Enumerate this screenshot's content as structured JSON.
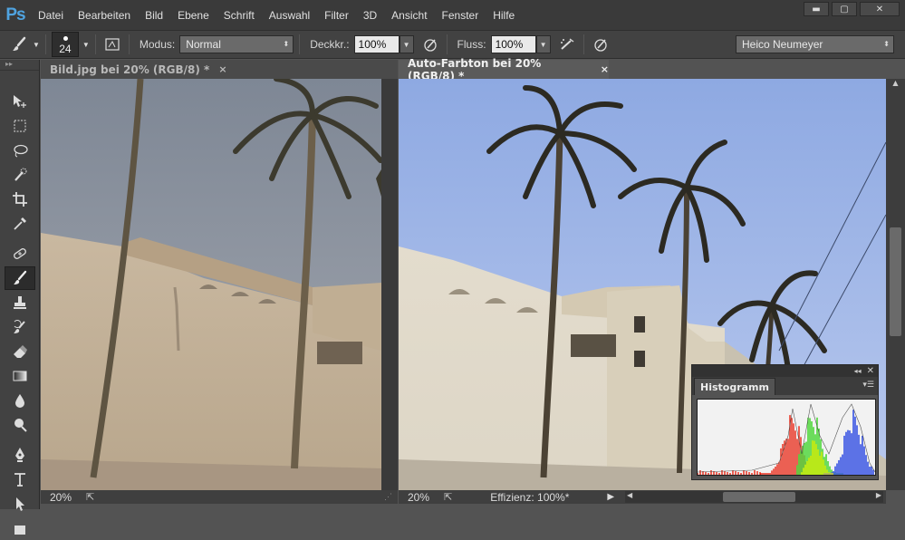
{
  "app": {
    "logo": "Ps"
  },
  "menu": [
    "Datei",
    "Bearbeiten",
    "Bild",
    "Ebene",
    "Schrift",
    "Auswahl",
    "Filter",
    "3D",
    "Ansicht",
    "Fenster",
    "Hilfe"
  ],
  "window_controls": {
    "minimize": "▬",
    "restore": "▢",
    "close": "✕"
  },
  "options": {
    "brush_size": "24",
    "mode_label": "Modus:",
    "mode_value": "Normal",
    "opacity_label": "Deckkr.:",
    "opacity_value": "100%",
    "flow_label": "Fluss:",
    "flow_value": "100%",
    "workspace": "Heico Neumeyer"
  },
  "documents": [
    {
      "tab": "Bild.jpg bei 20% (RGB/8) *",
      "zoom": "20%",
      "status": ""
    },
    {
      "tab": "Auto-Farbton bei 20% (RGB/8) *",
      "zoom": "20%",
      "status": "Effizienz: 100%*"
    }
  ],
  "tab_close": "×",
  "histogram": {
    "title": "Histogramm"
  },
  "tools": [
    "move-tool-icon",
    "marquee-tool-icon",
    "lasso-tool-icon",
    "quick-selection-icon",
    "crop-tool-icon",
    "eyedropper-icon",
    "healing-brush-icon",
    "brush-tool-icon",
    "clone-stamp-icon",
    "history-brush-icon",
    "eraser-icon",
    "gradient-icon",
    "blur-icon",
    "dodge-icon",
    "pen-tool-icon",
    "type-tool-icon",
    "path-selection-icon",
    "shape-tool-icon"
  ],
  "colors": {
    "accent": "#4fa3e0",
    "ui_dark": "#3a3a3a",
    "ui_mid": "#535353",
    "hist_red": "#e8210f",
    "hist_green": "#33d21c",
    "hist_blue": "#1c3be0",
    "hist_yellow": "#f2f21a"
  }
}
